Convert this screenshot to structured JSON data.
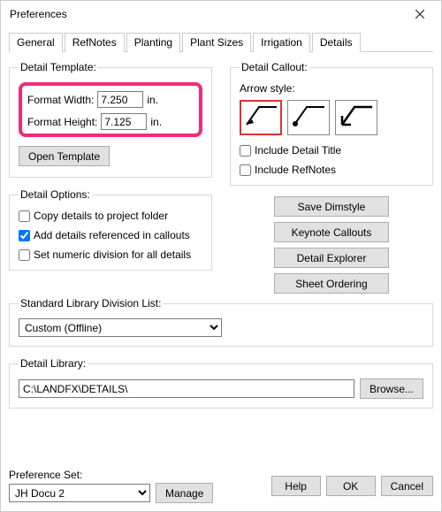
{
  "window": {
    "title": "Preferences"
  },
  "tabs": {
    "general": "General",
    "refnotes": "RefNotes",
    "planting": "Planting",
    "plantsizes": "Plant Sizes",
    "irrigation": "Irrigation",
    "details": "Details"
  },
  "detail_template": {
    "legend": "Detail Template:",
    "format_width_label": "Format Width:",
    "format_width_value": "7.250",
    "format_height_label": "Format Height:",
    "format_height_value": "7.125",
    "unit": "in.",
    "open_template": "Open Template"
  },
  "detail_options": {
    "legend": "Detail Options:",
    "copy_details": "Copy details to project folder",
    "copy_details_checked": false,
    "add_details": "Add details referenced in callouts",
    "add_details_checked": true,
    "numeric_division": "Set numeric division for all details",
    "numeric_division_checked": false
  },
  "std_lib": {
    "legend": "Standard Library Division List:",
    "value": "Custom (Offline)"
  },
  "detail_library": {
    "legend": "Detail Library:",
    "path": "C:\\LANDFX\\DETAILS\\",
    "browse": "Browse..."
  },
  "detail_callout": {
    "legend": "Detail Callout:",
    "arrow_style_label": "Arrow style:",
    "include_title": "Include Detail Title",
    "include_title_checked": false,
    "include_refnotes": "Include RefNotes",
    "include_refnotes_checked": false
  },
  "side_buttons": {
    "save_dimstyle": "Save Dimstyle",
    "keynote_callouts": "Keynote Callouts",
    "detail_explorer": "Detail Explorer",
    "sheet_ordering": "Sheet Ordering"
  },
  "footer": {
    "pref_set_label": "Preference Set:",
    "pref_set_value": "JH Docu 2",
    "manage": "Manage",
    "help": "Help",
    "ok": "OK",
    "cancel": "Cancel"
  }
}
